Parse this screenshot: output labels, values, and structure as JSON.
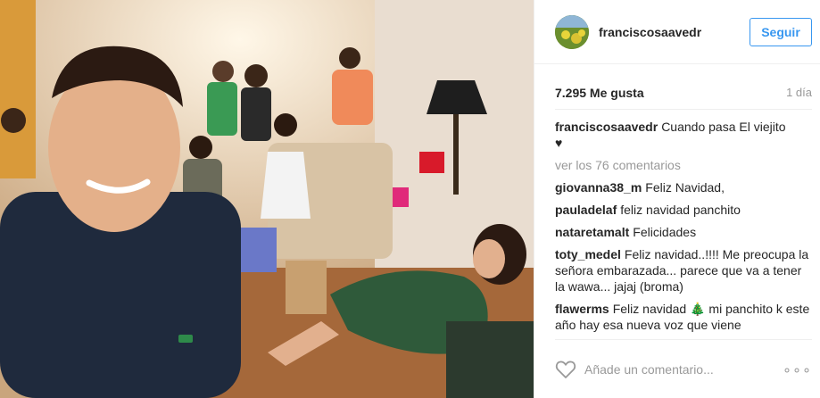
{
  "post": {
    "username": "franciscosaavedr",
    "follow_label": "Seguir",
    "likes": "7.295 Me gusta",
    "time": "1 día",
    "caption_user": "franciscosaavedr",
    "caption_text": "Cuando pasa El viejito",
    "caption_emoji": "♥",
    "view_all": "ver los 76 comentarios"
  },
  "comments": [
    {
      "user": "giovanna38_m",
      "text": "Feliz Navidad,"
    },
    {
      "user": "pauladelaf",
      "text": "feliz navidad panchito"
    },
    {
      "user": "nataretamalt",
      "text": "Felicidades"
    },
    {
      "user": "toty_medel",
      "text": "Feliz navidad..!!!! Me preocupa la señora embarazada... parece que va a tener la wawa... jajaj (broma)"
    },
    {
      "user": "flawerms",
      "text": "Feliz navidad 🎄 mi panchito k este año hay esa nueva voz que viene"
    }
  ],
  "composer": {
    "placeholder": "Añade un comentario...",
    "more": "∘∘∘"
  },
  "colors": {
    "accent": "#3897f0",
    "muted": "#999999",
    "border": "#efefef"
  },
  "icons": [
    "heart-icon",
    "more-icon"
  ]
}
